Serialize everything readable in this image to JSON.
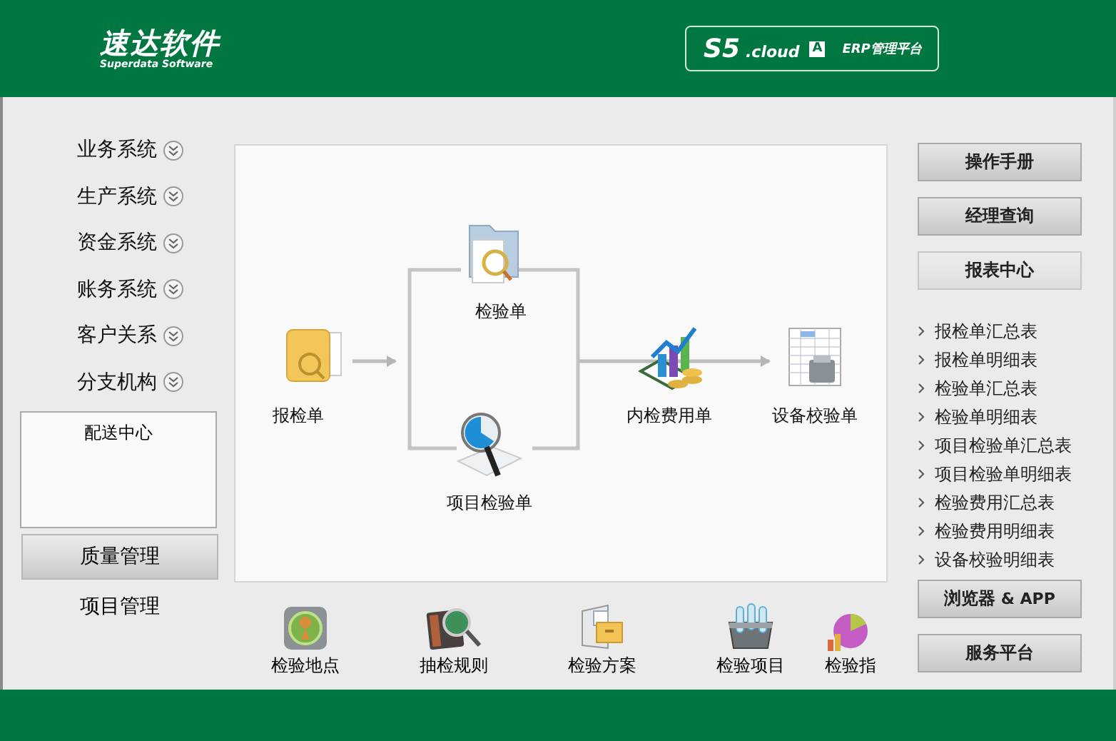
{
  "header": {
    "logo_text": "速达软件",
    "logo_subtitle": "Superdata Software",
    "product": {
      "version": "S5",
      "edition": ".cloud",
      "badge": "A",
      "platform": "ERP管理平台"
    }
  },
  "sidebar": {
    "items": [
      {
        "label": "业务系统",
        "expanded": false
      },
      {
        "label": "生产系统",
        "expanded": false
      },
      {
        "label": "资金系统",
        "expanded": false
      },
      {
        "label": "账务系统",
        "expanded": false
      },
      {
        "label": "客户关系",
        "expanded": false
      },
      {
        "label": "分支机构",
        "expanded": false
      }
    ],
    "list": [
      "配送中心"
    ],
    "modules": [
      {
        "label": "质量管理",
        "selected": true
      },
      {
        "label": "项目管理",
        "selected": false
      }
    ]
  },
  "diagram": {
    "nodes": [
      {
        "label": "报检单",
        "kind": "folder"
      },
      {
        "label": "检验单",
        "kind": "search-folder"
      },
      {
        "label": "项目检验单",
        "kind": "pie-magnifier"
      },
      {
        "label": "内检费用单",
        "kind": "chart-coins"
      },
      {
        "label": "设备校验单",
        "kind": "spreadsheet"
      }
    ]
  },
  "shortcuts": [
    {
      "label": "检验地点",
      "kind": "location"
    },
    {
      "label": "抽检规则",
      "kind": "book-magnifier"
    },
    {
      "label": "检验方案",
      "kind": "file-box"
    },
    {
      "label": "检验项目",
      "kind": "test-tubes"
    },
    {
      "label": "检验指",
      "kind": "pie-chart"
    }
  ],
  "right_panel": {
    "buttons": [
      "操作手册",
      "经理查询"
    ],
    "report_heading": "报表中心",
    "reports": [
      "报检单汇总表",
      "报检单明细表",
      "检验单汇总表",
      "检验单明细表",
      "项目检验单汇总表",
      "项目检验单明细表",
      "检验费用汇总表",
      "检验费用明细表",
      "设备校验明细表"
    ],
    "bottom_buttons": [
      {
        "label": "浏览器",
        "suffix": "& APP"
      },
      {
        "label": "服务平台"
      }
    ]
  }
}
